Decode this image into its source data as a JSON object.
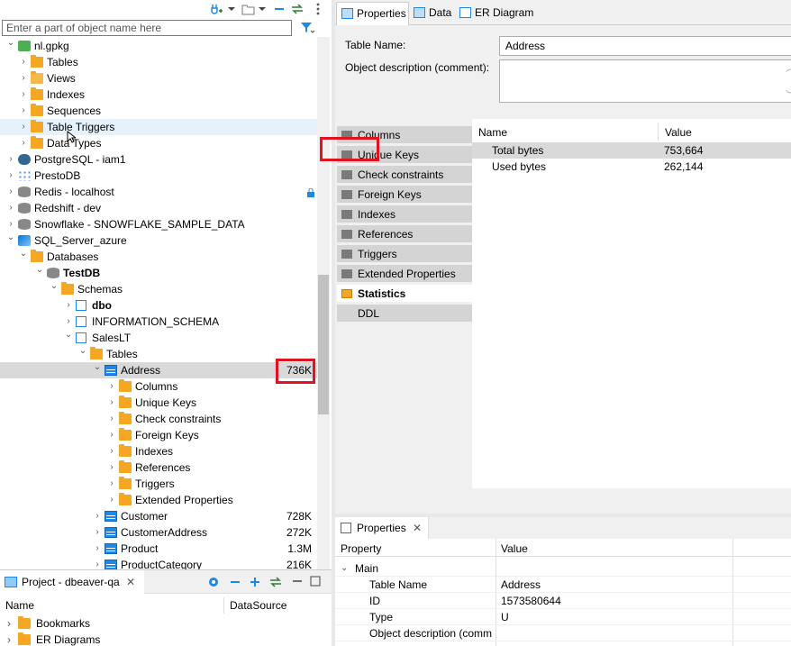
{
  "navigator": {
    "filter_placeholder": "Enter a part of object name here",
    "tree": [
      {
        "label": "nl.gpkg",
        "icon": "gpkg-icon",
        "level": 0,
        "expanded": true
      },
      {
        "label": "Tables",
        "icon": "tables-folder-icon",
        "level": 1
      },
      {
        "label": "Views",
        "icon": "views-icon",
        "level": 1
      },
      {
        "label": "Indexes",
        "icon": "folder-icon",
        "level": 1
      },
      {
        "label": "Sequences",
        "icon": "folder-icon",
        "level": 1
      },
      {
        "label": "Table Triggers",
        "icon": "folder-icon",
        "level": 1,
        "hover": true
      },
      {
        "label": "Data Types",
        "icon": "folder-icon",
        "level": 1
      },
      {
        "label": "PostgreSQL - iam1",
        "icon": "postgresql-icon",
        "level": 0
      },
      {
        "label": "PrestoDB",
        "icon": "prestodb-icon",
        "level": 0
      },
      {
        "label": "Redis - localhost",
        "icon": "database-icon",
        "level": 0
      },
      {
        "label": "Redshift - dev",
        "icon": "database-icon",
        "level": 0
      },
      {
        "label": "Snowflake - SNOWFLAKE_SAMPLE_DATA",
        "icon": "database-icon",
        "level": 0
      },
      {
        "label": "SQL_Server_azure",
        "icon": "sqlserver-icon",
        "level": 0,
        "expanded": true
      },
      {
        "label": "Databases",
        "icon": "folder-icon",
        "level": 1,
        "expanded": true
      },
      {
        "label": "TestDB",
        "icon": "database-icon",
        "level": 2,
        "expanded": true,
        "bold": true
      },
      {
        "label": "Schemas",
        "icon": "folder-icon",
        "level": 3,
        "expanded": true
      },
      {
        "label": "dbo",
        "icon": "schema-icon",
        "level": 4,
        "bold": true
      },
      {
        "label": "INFORMATION_SCHEMA",
        "icon": "schema-icon",
        "level": 4
      },
      {
        "label": "SalesLT",
        "icon": "schema-icon",
        "level": 4,
        "expanded": true
      },
      {
        "label": "Tables",
        "icon": "tables-folder-icon",
        "level": 5,
        "expanded": true
      },
      {
        "label": "Address",
        "icon": "table-icon",
        "level": 6,
        "expanded": true,
        "selected": true,
        "size": "736K"
      },
      {
        "label": "Columns",
        "icon": "folder-icon",
        "level": 7
      },
      {
        "label": "Unique Keys",
        "icon": "folder-icon",
        "level": 7
      },
      {
        "label": "Check constraints",
        "icon": "folder-icon",
        "level": 7
      },
      {
        "label": "Foreign Keys",
        "icon": "folder-icon",
        "level": 7
      },
      {
        "label": "Indexes",
        "icon": "folder-icon",
        "level": 7
      },
      {
        "label": "References",
        "icon": "folder-icon",
        "level": 7
      },
      {
        "label": "Triggers",
        "icon": "folder-icon",
        "level": 7
      },
      {
        "label": "Extended Properties",
        "icon": "folder-icon",
        "level": 7
      },
      {
        "label": "Customer",
        "icon": "table-icon",
        "level": 6,
        "size": "728K"
      },
      {
        "label": "CustomerAddress",
        "icon": "table-icon",
        "level": 6,
        "size": "272K"
      },
      {
        "label": "Product",
        "icon": "table-icon",
        "level": 6,
        "size": "1.3M"
      },
      {
        "label": "ProductCategory",
        "icon": "table-icon",
        "level": 6,
        "size": "216K"
      }
    ]
  },
  "project": {
    "tab_label": "Project - dbeaver-qa",
    "col_name": "Name",
    "col_datasource": "DataSource",
    "items": [
      {
        "label": "Bookmarks",
        "icon": "bookmarks-icon"
      },
      {
        "label": "ER Diagrams",
        "icon": "er-diagrams-icon"
      }
    ]
  },
  "editor": {
    "tabs": [
      {
        "label": "Properties",
        "icon": "properties-icon",
        "active": true
      },
      {
        "label": "Data",
        "icon": "data-icon"
      },
      {
        "label": "ER Diagram",
        "icon": "er-diagram-icon"
      }
    ],
    "table_name_label": "Table Name:",
    "table_name_value": "Address",
    "object_desc_label": "Object description (comment):",
    "side_tabs": [
      {
        "label": "Columns"
      },
      {
        "label": "Unique Keys"
      },
      {
        "label": "Check constraints"
      },
      {
        "label": "Foreign Keys"
      },
      {
        "label": "Indexes"
      },
      {
        "label": "References"
      },
      {
        "label": "Triggers"
      },
      {
        "label": "Extended Properties"
      },
      {
        "label": "Statistics",
        "active": true
      },
      {
        "label": "DDL"
      }
    ],
    "stats": {
      "col_name": "Name",
      "col_value": "Value",
      "rows": [
        {
          "name": "Total bytes",
          "value": "753,664",
          "selected": true
        },
        {
          "name": "Used bytes",
          "value": "262,144"
        }
      ]
    }
  },
  "properties_panel": {
    "tab_label": "Properties",
    "col_property": "Property",
    "col_value": "Value",
    "group": "Main",
    "rows": [
      {
        "name": "Table Name",
        "value": "Address"
      },
      {
        "name": "ID",
        "value": "1573580644"
      },
      {
        "name": "Type",
        "value": "U"
      },
      {
        "name": "Object description (comm",
        "value": ""
      }
    ]
  },
  "colors": {
    "highlight": "#e0141e",
    "selection": "#d9d9d9",
    "accent": "#1e88e5",
    "folder": "#f5a623"
  }
}
